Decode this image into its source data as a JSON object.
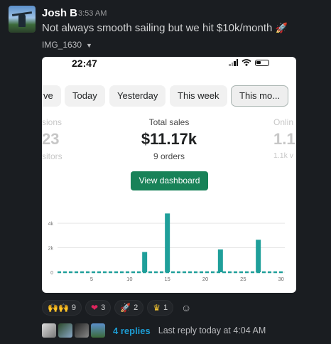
{
  "message": {
    "author": "Josh B",
    "time": "3:53 AM",
    "text": "Not always smooth sailing but we hit $10k/month",
    "emoji": "rocket",
    "attachment": {
      "name": "IMG_1630"
    }
  },
  "phone": {
    "status_time": "22:47",
    "tabs": [
      {
        "label": "ve"
      },
      {
        "label": "Today"
      },
      {
        "label": "Yesterday"
      },
      {
        "label": "This week"
      },
      {
        "label": "This mo..."
      }
    ],
    "metrics": {
      "left": {
        "label": "sions",
        "value": "23",
        "sub": "sitors"
      },
      "center": {
        "label": "Total sales",
        "value": "$11.17k",
        "sub": "9 orders"
      },
      "right": {
        "label": "Onlin",
        "value": "1.1",
        "sub": "1.1k v"
      }
    },
    "dashboard_button": "View dashboard"
  },
  "chart_data": {
    "type": "bar",
    "x": [
      1,
      2,
      3,
      4,
      5,
      6,
      7,
      8,
      9,
      10,
      11,
      12,
      13,
      14,
      15,
      16,
      17,
      18,
      19,
      20,
      21,
      22,
      23,
      24,
      25,
      26,
      27,
      28,
      29,
      30
    ],
    "values": [
      0,
      0,
      0,
      0,
      0,
      0,
      0,
      0,
      0,
      0,
      0,
      1650,
      0,
      0,
      4800,
      0,
      0,
      0,
      0,
      0,
      0,
      1860,
      0,
      0,
      0,
      0,
      2650,
      0,
      0,
      0
    ],
    "xticks": [
      "5",
      "10",
      "15",
      "20",
      "25",
      "30"
    ],
    "yticks": [
      "0",
      "2k",
      "4k"
    ],
    "ylim": [
      0,
      5400
    ],
    "color": "#1f9f9a"
  },
  "reactions": [
    {
      "emoji": "raised-hands",
      "count": "9"
    },
    {
      "emoji": "heart",
      "count": "3"
    },
    {
      "emoji": "rocket",
      "count": "2"
    },
    {
      "emoji": "crown",
      "count": "1"
    }
  ],
  "thread": {
    "replies": "4 replies",
    "last_reply": "Last reply today at 4:04 AM"
  }
}
